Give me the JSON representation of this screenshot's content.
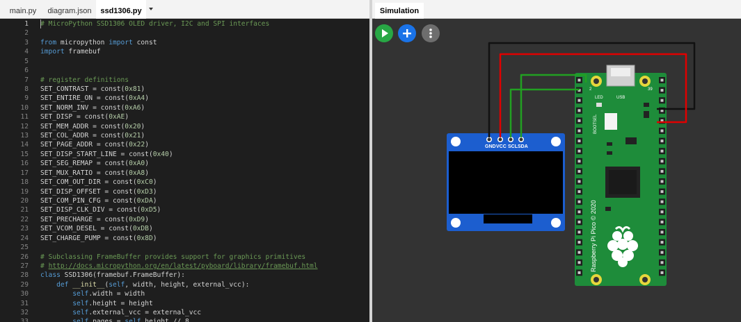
{
  "editor": {
    "tabs": [
      {
        "label": "main.py"
      },
      {
        "label": "diagram.json"
      },
      {
        "label": "ssd1306.py"
      }
    ],
    "lines": [
      {
        "n": "1",
        "tokens": [
          {
            "c": "com",
            "t": "# MicroPython SSD1306 OLED driver, I2C and SPI interfaces"
          }
        ]
      },
      {
        "n": "2",
        "tokens": []
      },
      {
        "n": "3",
        "tokens": [
          {
            "c": "kw",
            "t": "from"
          },
          {
            "c": "id",
            "t": " micropython "
          },
          {
            "c": "kw",
            "t": "import"
          },
          {
            "c": "id",
            "t": " const"
          }
        ]
      },
      {
        "n": "4",
        "tokens": [
          {
            "c": "kw",
            "t": "import"
          },
          {
            "c": "id",
            "t": " framebuf"
          }
        ]
      },
      {
        "n": "5",
        "tokens": []
      },
      {
        "n": "6",
        "tokens": []
      },
      {
        "n": "7",
        "tokens": [
          {
            "c": "com",
            "t": "# register definitions"
          }
        ]
      },
      {
        "n": "8",
        "tokens": [
          {
            "c": "id",
            "t": "SET_CONTRAST = const("
          },
          {
            "c": "num",
            "t": "0x81"
          },
          {
            "c": "id",
            "t": ")"
          }
        ]
      },
      {
        "n": "9",
        "tokens": [
          {
            "c": "id",
            "t": "SET_ENTIRE_ON = const("
          },
          {
            "c": "num",
            "t": "0xA4"
          },
          {
            "c": "id",
            "t": ")"
          }
        ]
      },
      {
        "n": "10",
        "tokens": [
          {
            "c": "id",
            "t": "SET_NORM_INV = const("
          },
          {
            "c": "num",
            "t": "0xA6"
          },
          {
            "c": "id",
            "t": ")"
          }
        ]
      },
      {
        "n": "11",
        "tokens": [
          {
            "c": "id",
            "t": "SET_DISP = const("
          },
          {
            "c": "num",
            "t": "0xAE"
          },
          {
            "c": "id",
            "t": ")"
          }
        ]
      },
      {
        "n": "12",
        "tokens": [
          {
            "c": "id",
            "t": "SET_MEM_ADDR = const("
          },
          {
            "c": "num",
            "t": "0x20"
          },
          {
            "c": "id",
            "t": ")"
          }
        ]
      },
      {
        "n": "13",
        "tokens": [
          {
            "c": "id",
            "t": "SET_COL_ADDR = const("
          },
          {
            "c": "num",
            "t": "0x21"
          },
          {
            "c": "id",
            "t": ")"
          }
        ]
      },
      {
        "n": "14",
        "tokens": [
          {
            "c": "id",
            "t": "SET_PAGE_ADDR = const("
          },
          {
            "c": "num",
            "t": "0x22"
          },
          {
            "c": "id",
            "t": ")"
          }
        ]
      },
      {
        "n": "15",
        "tokens": [
          {
            "c": "id",
            "t": "SET_DISP_START_LINE = const("
          },
          {
            "c": "num",
            "t": "0x40"
          },
          {
            "c": "id",
            "t": ")"
          }
        ]
      },
      {
        "n": "16",
        "tokens": [
          {
            "c": "id",
            "t": "SET_SEG_REMAP = const("
          },
          {
            "c": "num",
            "t": "0xA0"
          },
          {
            "c": "id",
            "t": ")"
          }
        ]
      },
      {
        "n": "17",
        "tokens": [
          {
            "c": "id",
            "t": "SET_MUX_RATIO = const("
          },
          {
            "c": "num",
            "t": "0xA8"
          },
          {
            "c": "id",
            "t": ")"
          }
        ]
      },
      {
        "n": "18",
        "tokens": [
          {
            "c": "id",
            "t": "SET_COM_OUT_DIR = const("
          },
          {
            "c": "num",
            "t": "0xC0"
          },
          {
            "c": "id",
            "t": ")"
          }
        ]
      },
      {
        "n": "19",
        "tokens": [
          {
            "c": "id",
            "t": "SET_DISP_OFFSET = const("
          },
          {
            "c": "num",
            "t": "0xD3"
          },
          {
            "c": "id",
            "t": ")"
          }
        ]
      },
      {
        "n": "20",
        "tokens": [
          {
            "c": "id",
            "t": "SET_COM_PIN_CFG = const("
          },
          {
            "c": "num",
            "t": "0xDA"
          },
          {
            "c": "id",
            "t": ")"
          }
        ]
      },
      {
        "n": "21",
        "tokens": [
          {
            "c": "id",
            "t": "SET_DISP_CLK_DIV = const("
          },
          {
            "c": "num",
            "t": "0xD5"
          },
          {
            "c": "id",
            "t": ")"
          }
        ]
      },
      {
        "n": "22",
        "tokens": [
          {
            "c": "id",
            "t": "SET_PRECHARGE = const("
          },
          {
            "c": "num",
            "t": "0xD9"
          },
          {
            "c": "id",
            "t": ")"
          }
        ]
      },
      {
        "n": "23",
        "tokens": [
          {
            "c": "id",
            "t": "SET_VCOM_DESEL = const("
          },
          {
            "c": "num",
            "t": "0xDB"
          },
          {
            "c": "id",
            "t": ")"
          }
        ]
      },
      {
        "n": "24",
        "tokens": [
          {
            "c": "id",
            "t": "SET_CHARGE_PUMP = const("
          },
          {
            "c": "num",
            "t": "0x8D"
          },
          {
            "c": "id",
            "t": ")"
          }
        ]
      },
      {
        "n": "25",
        "tokens": []
      },
      {
        "n": "26",
        "tokens": [
          {
            "c": "com",
            "t": "# Subclassing FrameBuffer provides support for graphics primitives"
          }
        ]
      },
      {
        "n": "27",
        "tokens": [
          {
            "c": "com",
            "t": "# "
          },
          {
            "c": "link",
            "t": "http://docs.micropython.org/en/latest/pyboard/library/framebuf.html"
          }
        ]
      },
      {
        "n": "28",
        "tokens": [
          {
            "c": "kw",
            "t": "class"
          },
          {
            "c": "id",
            "t": " SSD1306(framebuf.FrameBuffer):"
          }
        ]
      },
      {
        "n": "29",
        "tokens": [
          {
            "c": "id",
            "t": "    "
          },
          {
            "c": "kw",
            "t": "def"
          },
          {
            "c": "id",
            "t": " "
          },
          {
            "c": "fn",
            "t": "__init__"
          },
          {
            "c": "id",
            "t": "("
          },
          {
            "c": "kw",
            "t": "self"
          },
          {
            "c": "id",
            "t": ", width, height, external_vcc):"
          }
        ]
      },
      {
        "n": "30",
        "tokens": [
          {
            "c": "id",
            "t": "        "
          },
          {
            "c": "kw",
            "t": "self"
          },
          {
            "c": "id",
            "t": ".width = width"
          }
        ]
      },
      {
        "n": "31",
        "tokens": [
          {
            "c": "id",
            "t": "        "
          },
          {
            "c": "kw",
            "t": "self"
          },
          {
            "c": "id",
            "t": ".height = height"
          }
        ]
      },
      {
        "n": "32",
        "tokens": [
          {
            "c": "id",
            "t": "        "
          },
          {
            "c": "kw",
            "t": "self"
          },
          {
            "c": "id",
            "t": ".external_vcc = external_vcc"
          }
        ]
      },
      {
        "n": "33",
        "tokens": [
          {
            "c": "id",
            "t": "        "
          },
          {
            "c": "kw",
            "t": "self"
          },
          {
            "c": "id",
            "t": ".pages = "
          },
          {
            "c": "kw",
            "t": "self"
          },
          {
            "c": "id",
            "t": ".height // 8"
          }
        ]
      }
    ]
  },
  "simulation": {
    "tab_label": "Simulation",
    "buttons": {
      "play_icon": "play-icon",
      "add_icon": "plus-icon",
      "more_icon": "vertical-dots-icon"
    },
    "oled": {
      "pins": [
        "GND",
        "VCC",
        "SCL",
        "SDA"
      ]
    },
    "pico": {
      "pin_left_top": "2",
      "pin_right_top": "39",
      "led_label": "LED",
      "usb_label": "USB",
      "bootsel_label": "BOOTSEL",
      "board_text": "Raspberry Pi Pico © 2020"
    },
    "colors": {
      "board_green": "#1e8c3a",
      "wire_red": "#e00000",
      "wire_green": "#22a022",
      "wire_black": "#111111",
      "oled_blue": "#1c5ecf"
    }
  }
}
